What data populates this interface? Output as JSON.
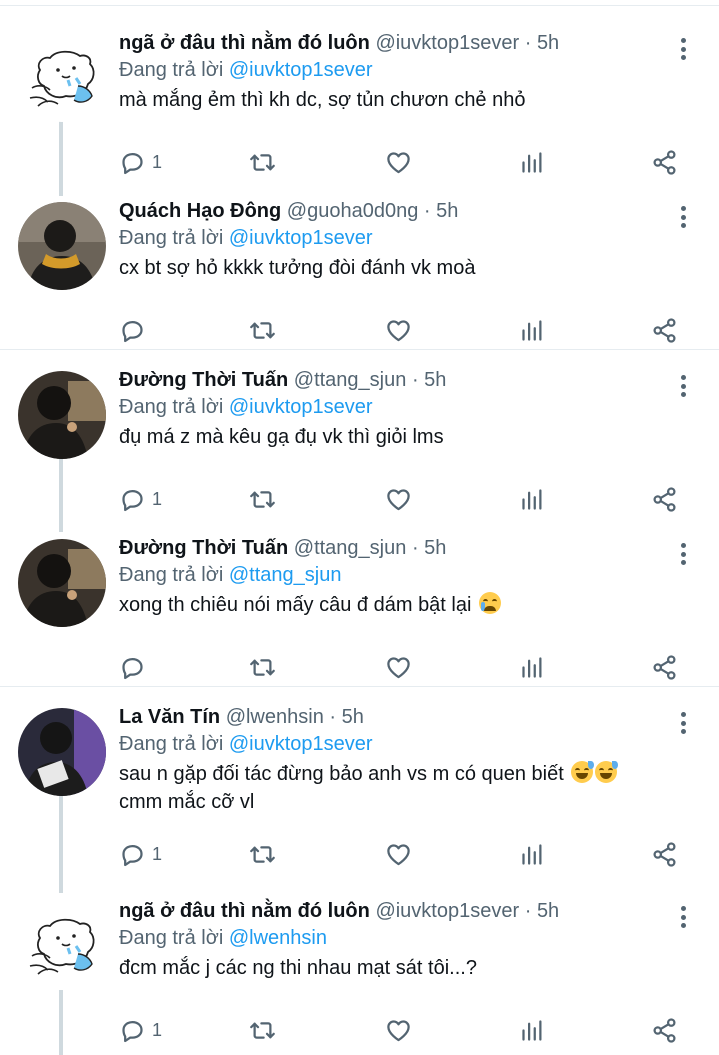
{
  "tweets": [
    {
      "name": "ngã ở đâu thì nằm đó luôn",
      "handle": "@iuvktop1sever",
      "sep": "·",
      "time": "5h",
      "reply_prefix": "Đang trả lời",
      "reply_to": "@iuvktop1sever",
      "text": "mà mắng ẻm thì kh dc, sợ tủn chươn chẻ nhỏ",
      "text2": "",
      "emoji": "",
      "reply_count": "1",
      "avatar": "cartoon-bear-avatar"
    },
    {
      "name": "Quách Hạo Đông",
      "handle": "@guoha0d0ng",
      "sep": "·",
      "time": "5h",
      "reply_prefix": "Đang trả lời",
      "reply_to": "@iuvktop1sever",
      "text": "cx bt sợ hỏ kkkk tưởng đòi đánh vk moà",
      "text2": "",
      "emoji": "",
      "reply_count": "",
      "avatar": "person-photo-avatar"
    },
    {
      "name": "Đường Thời Tuấn",
      "handle": "@ttang_sjun",
      "sep": "·",
      "time": "5h",
      "reply_prefix": "Đang trả lời",
      "reply_to": "@iuvktop1sever",
      "text": "đụ má z mà kêu gạ đụ vk thì giỏi lms",
      "text2": "",
      "emoji": "",
      "reply_count": "1",
      "avatar": "person-photo-avatar"
    },
    {
      "name": "Đường Thời Tuấn",
      "handle": "@ttang_sjun",
      "sep": "·",
      "time": "5h",
      "reply_prefix": "Đang trả lời",
      "reply_to": "@ttang_sjun",
      "text": "xong th chiêu nói mấy câu đ dám bật lại",
      "text2": "",
      "emoji": "crying-face",
      "reply_count": "",
      "avatar": "person-photo-avatar"
    },
    {
      "name": "La Văn Tín",
      "handle": "@lwenhsin",
      "sep": "·",
      "time": "5h",
      "reply_prefix": "Đang trả lời",
      "reply_to": "@iuvktop1sever",
      "text": "sau n gặp đối tác đừng bảo anh vs m có quen biết",
      "text2": "cmm mắc cỡ vl",
      "emoji": "grinning-sweat-face x2",
      "reply_count": "1",
      "avatar": "person-photo-avatar"
    },
    {
      "name": "ngã ở đâu thì nằm đó luôn",
      "handle": "@iuvktop1sever",
      "sep": "·",
      "time": "5h",
      "reply_prefix": "Đang trả lời",
      "reply_to": "@lwenhsin",
      "text": "đcm mắc j các ng thi nhau mạt sát tôi...?",
      "text2": "",
      "emoji": "",
      "reply_count": "1",
      "avatar": "cartoon-bear-avatar"
    }
  ],
  "colors": {
    "accent": "#1d9bf0",
    "secondary_text": "#536471",
    "primary_text": "#0f1419",
    "divider": "#e6ecf0",
    "thread_line": "#cfd9de"
  }
}
